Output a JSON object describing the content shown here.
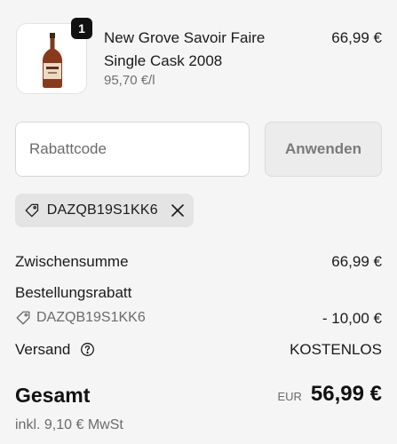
{
  "cart_item": {
    "quantity": "1",
    "name_line1": "New Grove Savoir Faire",
    "name_line2": "Single Cask 2008",
    "unit_price": "95,70 €/l",
    "price": "66,99 €"
  },
  "discount": {
    "placeholder": "Rabattcode",
    "value": "",
    "apply_label": "Anwenden",
    "applied_code": "DAZQB19S1KK6"
  },
  "summary": {
    "subtotal_label": "Zwischensumme",
    "subtotal_value": "66,99 €",
    "order_discount_label": "Bestellungsrabatt",
    "order_discount_code": "DAZQB19S1KK6",
    "order_discount_value": "- 10,00 €",
    "shipping_label": "Versand",
    "shipping_value": "KOSTENLOS",
    "total_label": "Gesamt",
    "currency": "EUR",
    "total_value": "56,99 €",
    "tax_note": "inkl. 9,10 € MwSt"
  },
  "icons": {
    "tag": "tag-icon",
    "close": "close-icon",
    "help": "help-circle-icon"
  }
}
